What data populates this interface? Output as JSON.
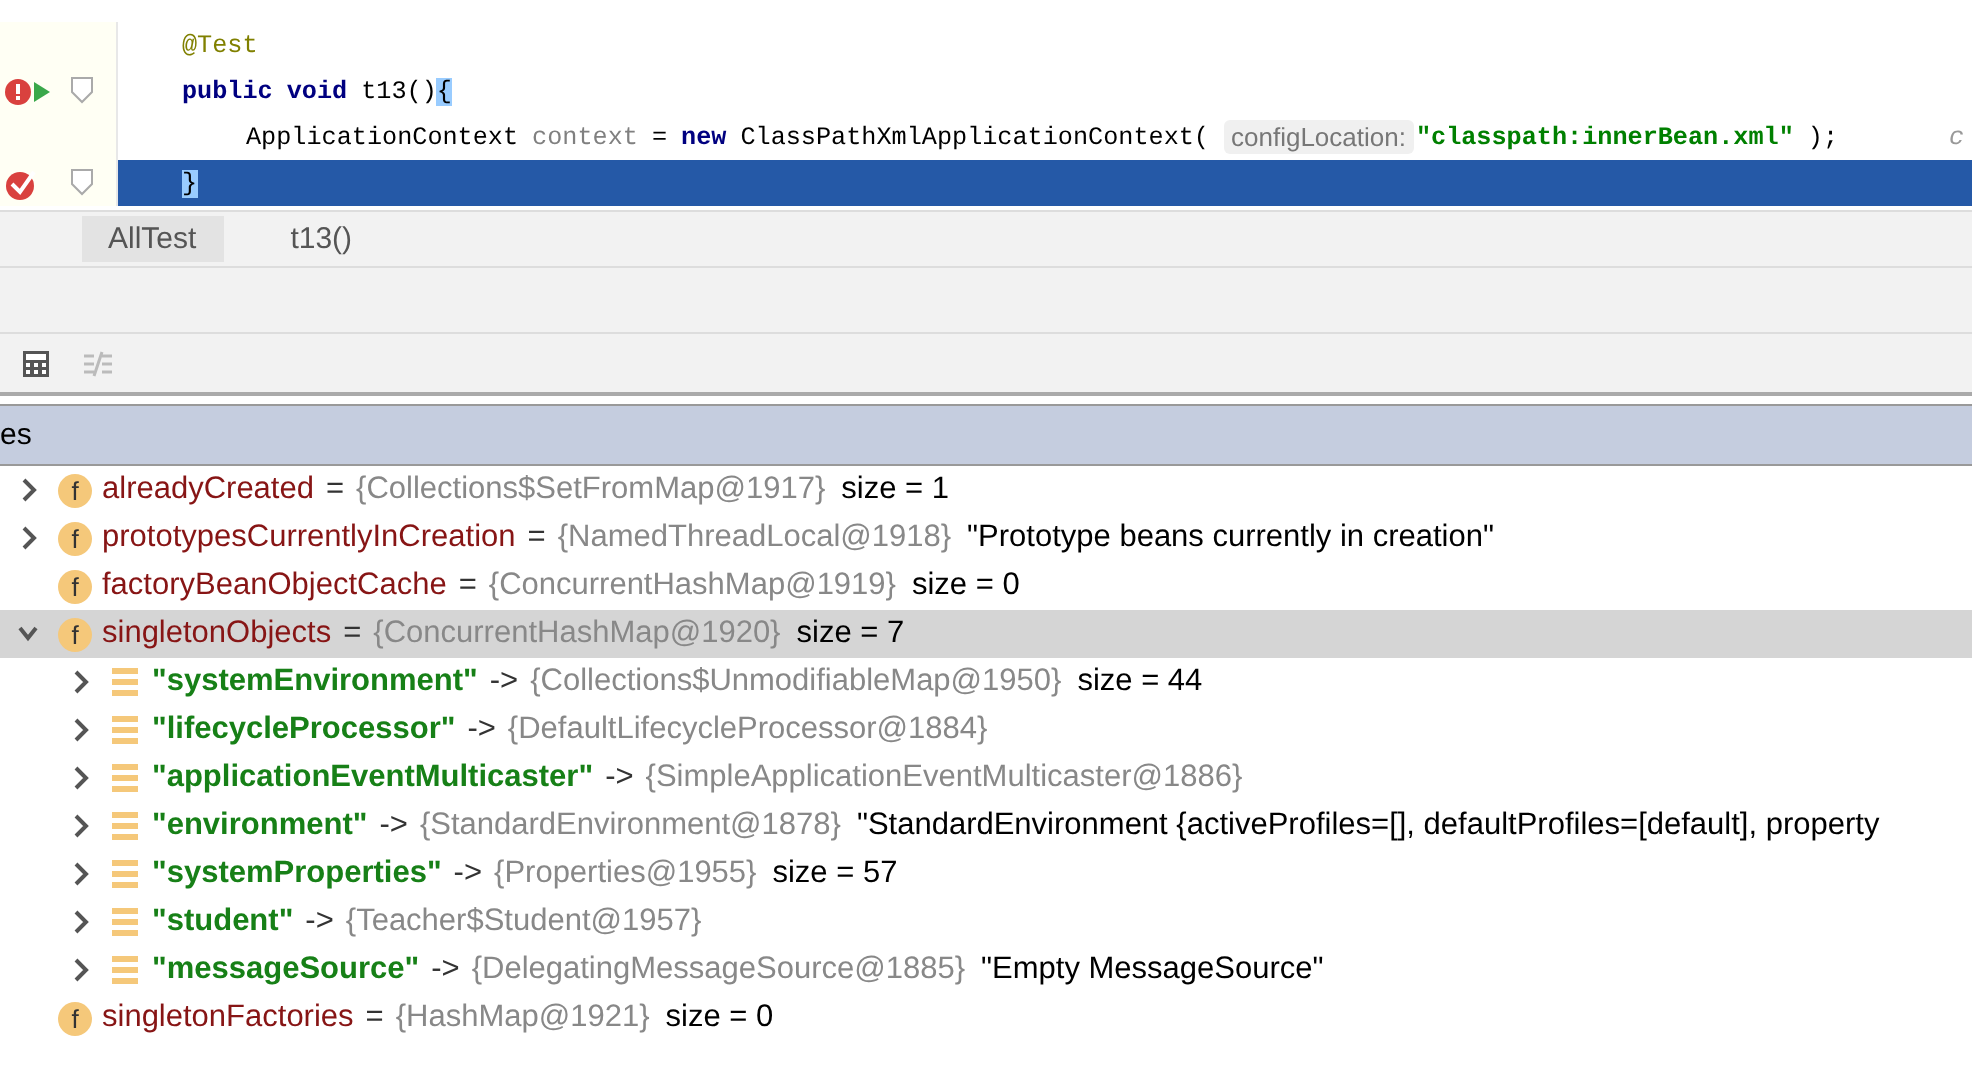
{
  "editor": {
    "lines": [
      {
        "breakpoint": false,
        "fold": false,
        "current": false,
        "tokens": [
          {
            "kind": "annotation",
            "text": "@Test"
          }
        ]
      },
      {
        "breakpoint": true,
        "valid": false,
        "runnable": true,
        "fold": true,
        "current": false,
        "tokens": [
          {
            "kind": "keyword",
            "text": "public"
          },
          {
            "kind": "keyword",
            "text": "void"
          },
          {
            "kind": "plain",
            "text": "t13()"
          },
          {
            "kind": "brace",
            "text": "{"
          }
        ],
        "children": [
          {
            "breakpoint": false,
            "fold": false,
            "current": false,
            "tokens": [
              {
                "kind": "plain",
                "text": "ApplicationContext"
              },
              {
                "kind": "unused",
                "text": "context"
              },
              {
                "kind": "plain",
                "text": "="
              },
              {
                "kind": "keyword",
                "text": "new"
              },
              {
                "kind": "plain",
                "text": "ClassPathXmlApplicationContext("
              },
              {
                "kind": "hint",
                "text": "configLocation:"
              },
              {
                "kind": "string",
                "text": "\"classpath:innerBean.xml\""
              },
              {
                "kind": "plain",
                "text": ");"
              }
            ],
            "trailing": "c"
          }
        ]
      },
      {
        "breakpoint": true,
        "valid": true,
        "runnable": false,
        "fold": true,
        "current": true,
        "tokens": [
          {
            "kind": "brace",
            "text": "}"
          }
        ]
      }
    ]
  },
  "breadcrumb": [
    {
      "label": "AllTest"
    },
    {
      "label": "t13()"
    }
  ],
  "panel": {
    "title": "es"
  },
  "tree": [
    {
      "kind": "field",
      "badge": "f",
      "name": "alreadyCreated",
      "op": "=",
      "ref": "{Collections$SetFromMap@1917}",
      "extra": "size = 1",
      "expanded": false,
      "selected": false
    },
    {
      "kind": "field",
      "badge": "f",
      "name": "prototypesCurrentlyInCreation",
      "op": "=",
      "ref": "{NamedThreadLocal@1918}",
      "extra": "\"Prototype beans currently in creation\"",
      "expanded": false,
      "selected": false
    },
    {
      "kind": "field",
      "badge": "f",
      "name": "factoryBeanObjectCache",
      "op": "=",
      "ref": "{ConcurrentHashMap@1919}",
      "extra": "size = 0",
      "selected": false
    },
    {
      "kind": "field",
      "badge": "f",
      "name": "singletonObjects",
      "op": "=",
      "ref": "{ConcurrentHashMap@1920}",
      "extra": "size = 7",
      "expanded": true,
      "selected": true,
      "children": [
        {
          "kind": "entry",
          "name": "\"systemEnvironment\"",
          "op": "->",
          "ref": "{Collections$UnmodifiableMap@1950}",
          "extra": "size = 44",
          "expanded": false,
          "selected": false
        },
        {
          "kind": "entry",
          "name": "\"lifecycleProcessor\"",
          "op": "->",
          "ref": "{DefaultLifecycleProcessor@1884}",
          "expanded": false,
          "selected": false
        },
        {
          "kind": "entry",
          "name": "\"applicationEventMulticaster\"",
          "op": "->",
          "ref": "{SimpleApplicationEventMulticaster@1886}",
          "expanded": false,
          "selected": false
        },
        {
          "kind": "entry",
          "name": "\"environment\"",
          "op": "->",
          "ref": "{StandardEnvironment@1878}",
          "extra": "\"StandardEnvironment {activeProfiles=[], defaultProfiles=[default], property",
          "expanded": false,
          "selected": false
        },
        {
          "kind": "entry",
          "name": "\"systemProperties\"",
          "op": "->",
          "ref": "{Properties@1955}",
          "extra": "size = 57",
          "expanded": false,
          "selected": false
        },
        {
          "kind": "entry",
          "name": "\"student\"",
          "op": "->",
          "ref": "{Teacher$Student@1957}",
          "expanded": false,
          "selected": false
        },
        {
          "kind": "entry",
          "name": "\"messageSource\"",
          "op": "->",
          "ref": "{DelegatingMessageSource@1885}",
          "extra": "\"Empty MessageSource\"",
          "expanded": false,
          "selected": false
        }
      ]
    },
    {
      "kind": "field",
      "badge": "f",
      "name": "singletonFactories",
      "op": "=",
      "ref": "{HashMap@1921}",
      "extra": "size = 0",
      "selected": false
    }
  ]
}
